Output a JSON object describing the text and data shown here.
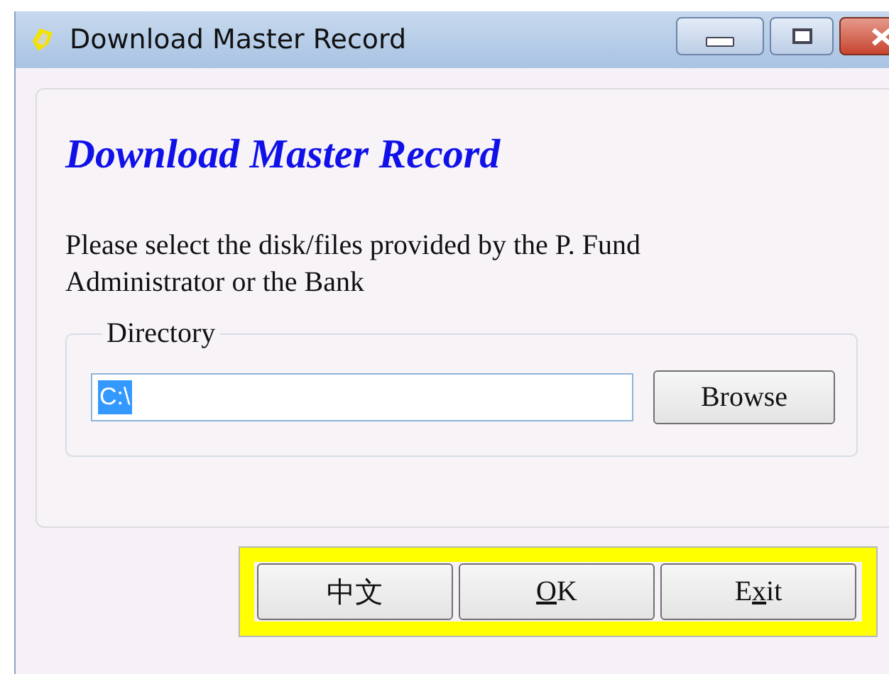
{
  "window": {
    "title": "Download Master Record"
  },
  "heading": "Download Master Record",
  "instructions": "Please select the disk/files provided by the P. Fund Administrator or the Bank",
  "directory": {
    "legend": "Directory",
    "value": "C:\\",
    "value_selected": true,
    "browse_button": "Browse"
  },
  "buttons": [
    {
      "key": "中文"
    },
    {
      "key": "O",
      "after": "K"
    },
    {
      "before": "E",
      "key": "x",
      "after": "it"
    }
  ]
}
